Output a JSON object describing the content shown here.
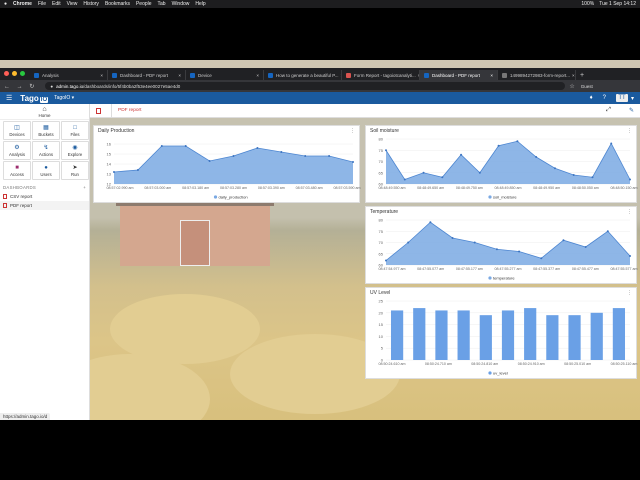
{
  "menubar": {
    "apple": "",
    "app": "Chrome",
    "items": [
      "File",
      "Edit",
      "View",
      "History",
      "Bookmarks",
      "People",
      "Tab",
      "Window",
      "Help"
    ],
    "right": [
      "100%",
      "Tue 1 Sep 14:12"
    ]
  },
  "tabs": [
    {
      "label": "Analysis",
      "active": false
    },
    {
      "label": "Dashboard - PDF report",
      "active": false
    },
    {
      "label": "Device",
      "active": false
    },
    {
      "label": "How to generate a beautiful P...",
      "active": false
    },
    {
      "label": "Form Report - tagoiotcanalyti...",
      "active": false
    },
    {
      "label": "Dashboard - PDF report",
      "active": true
    },
    {
      "label": "1499894272983-form-report...",
      "active": false
    }
  ],
  "address": {
    "host": "admin.tago.io",
    "path": "/dashboards/info/5f4b0ba2f53e4ee0027e5ae4d0",
    "guest": "Guest"
  },
  "header": {
    "logo": "Tago",
    "logo_badge": "IO",
    "account": "TagoIO",
    "avatar": "TT"
  },
  "sidebar": {
    "home": "Home",
    "grid": [
      {
        "label": "Devices",
        "icon": "device-icon"
      },
      {
        "label": "Buckets",
        "icon": "bucket-icon"
      },
      {
        "label": "Files",
        "icon": "file-icon"
      },
      {
        "label": "Analysis",
        "icon": "analysis-icon"
      },
      {
        "label": "Actions",
        "icon": "action-icon"
      },
      {
        "label": "Explore",
        "icon": "explore-icon"
      },
      {
        "label": "Access",
        "icon": "lock-icon"
      },
      {
        "label": "Users",
        "icon": "users-icon"
      },
      {
        "label": "Run",
        "icon": "rocket-icon"
      }
    ],
    "dashboards_title": "DASHBOARDS",
    "dashboards": [
      {
        "label": "CSV report",
        "active": false
      },
      {
        "label": "PDF report",
        "active": true
      }
    ],
    "status_url": "https://admin.tago.io/d"
  },
  "toolbar": {
    "dashboard_tab": "PDF report"
  },
  "widgets": {
    "daily_production": {
      "title": "Daily Production",
      "chart_data": {
        "type": "area",
        "title": "Daily Production",
        "x": [
          "08:57:02.990 am",
          "08:57:03.000 am",
          "08:57:03.180 am",
          "08:57:03.280 am",
          "08:57:03.390 am",
          "08:57:03.480 am",
          "08:57:03.590 am"
        ],
        "series": [
          {
            "name": "daily_production",
            "values": [
              13.2,
              13.4,
              15.8,
              15.8,
              14.3,
              14.8,
              15.6,
              15.2,
              14.8,
              14.8,
              14.2
            ]
          }
        ],
        "yticks": [
          12,
          13,
          14,
          15,
          16
        ],
        "ylim": [
          12,
          16.5
        ],
        "color": "#7aa9e3"
      }
    },
    "soil_moisture": {
      "title": "Soil moisture",
      "chart_data": {
        "type": "area",
        "title": "Soil moisture",
        "x": [
          "08:48:49.550 am",
          "08:48:49.650 am",
          "08:48:49.750 am",
          "08:48:49.850 am",
          "08:48:49.950 am",
          "08:48:50.050 am",
          "08:48:50.150 am"
        ],
        "series": [
          {
            "name": "soil_moisture",
            "values": [
              75,
              62,
              65,
              63,
              73,
              65,
              77,
              79,
              72,
              67,
              64,
              63,
              78,
              62
            ]
          }
        ],
        "yticks": [
          60,
          65,
          70,
          75,
          80
        ],
        "ylim": [
          60,
          80
        ],
        "color": "#7aa9e3"
      }
    },
    "temperature": {
      "title": "Temperature",
      "chart_data": {
        "type": "area",
        "title": "Temperature",
        "x": [
          "08:47:54.977 am",
          "08:47:55.077 am",
          "08:47:55.177 am",
          "08:47:55.277 am",
          "08:47:55.377 am",
          "08:47:55.477 am",
          "08:47:55.577 am"
        ],
        "series": [
          {
            "name": "temperature",
            "values": [
              62,
              70,
              79,
              72,
              70,
              67,
              66,
              63,
              71,
              68,
              75,
              64
            ]
          }
        ],
        "yticks": [
          60,
          65,
          70,
          75,
          80
        ],
        "ylim": [
          60,
          80
        ],
        "color": "#7aa9e3"
      }
    },
    "uv_level": {
      "title": "UV Level",
      "chart_data": {
        "type": "bar",
        "title": "UV Level",
        "x": [
          "08:50:24.610 am",
          "08:50:24.710 am",
          "08:50:24.810 am",
          "08:50:24.910 am",
          "08:50:25.010 am",
          "08:50:25.110 am"
        ],
        "series": [
          {
            "name": "uv_level",
            "values": [
              21,
              22,
              21,
              21,
              19,
              21,
              22,
              19,
              19,
              20,
              22
            ]
          }
        ],
        "yticks": [
          0,
          5,
          10,
          15,
          20,
          25
        ],
        "ylim": [
          0,
          25
        ],
        "color": "#6aa0e6"
      }
    }
  }
}
